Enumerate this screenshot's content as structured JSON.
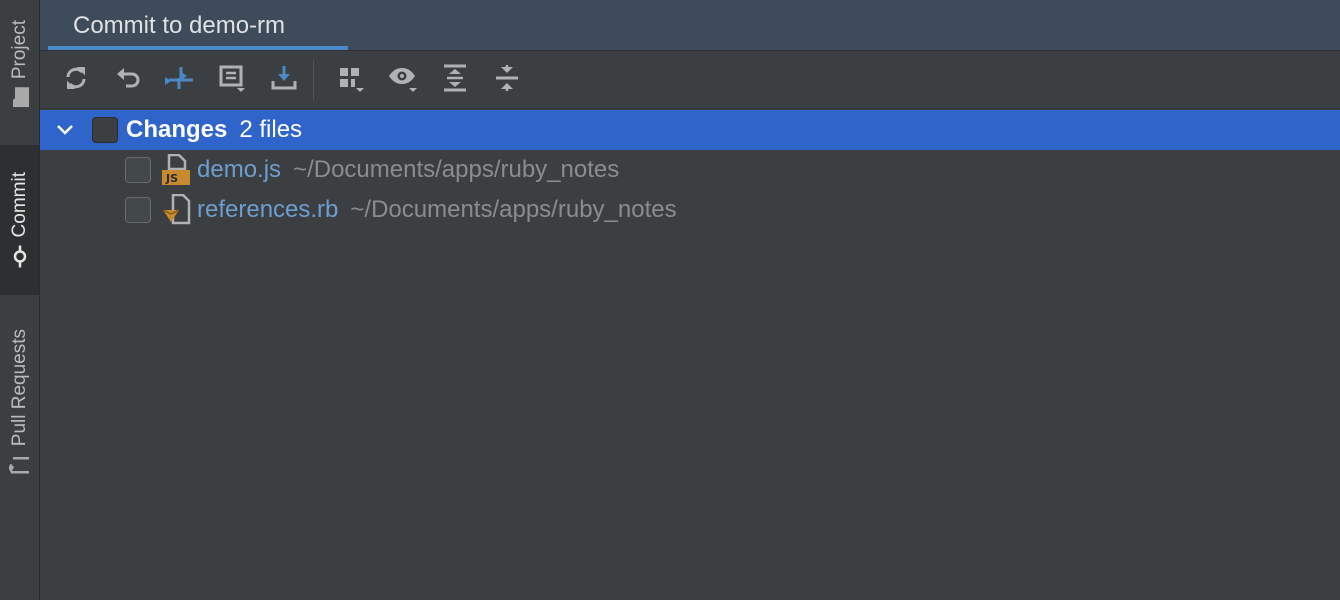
{
  "stripe": {
    "project_label": "Project",
    "commit_label": "Commit",
    "pull_requests_label": "Pull Requests"
  },
  "tab": {
    "title": "Commit to demo-rm"
  },
  "toolbar": {
    "buttons": [
      "refresh-icon",
      "rollback-icon",
      "show-diff-icon",
      "changelist-icon",
      "update-icon",
      "group-by-icon",
      "view-options-icon",
      "expand-all-icon",
      "collapse-all-icon"
    ]
  },
  "changes": {
    "group_name": "Changes",
    "count_label": "2 files",
    "files": [
      {
        "name": "demo.js",
        "path": "~/Documents/apps/ruby_notes",
        "type_badge": "JS"
      },
      {
        "name": "references.rb",
        "path": "~/Documents/apps/ruby_notes",
        "type_badge": ""
      }
    ]
  },
  "colors": {
    "selection": "#2f65ca",
    "accent": "#4a88c7",
    "file_link": "#6d9ecf",
    "js_badge": "#c88a2e"
  }
}
